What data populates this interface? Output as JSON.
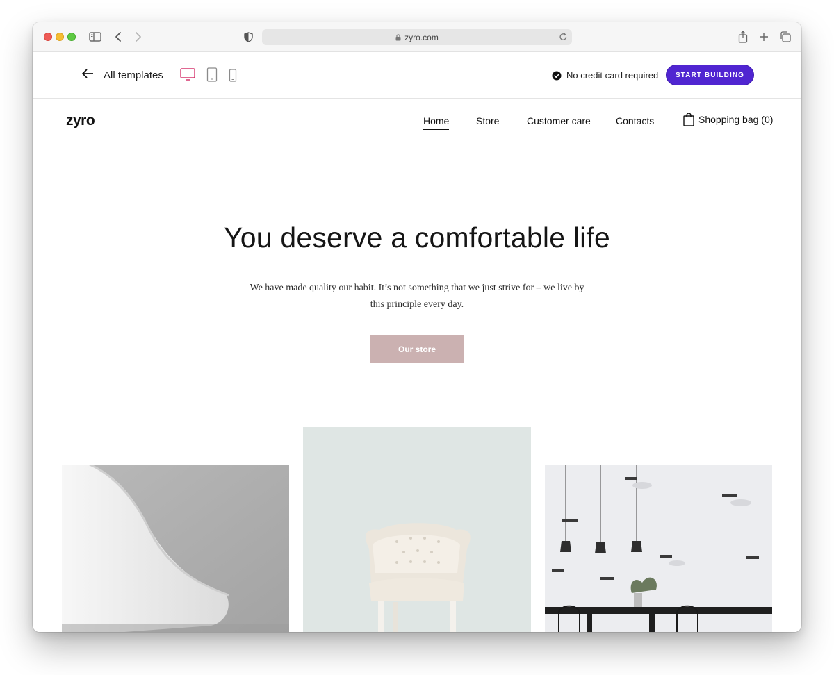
{
  "browser": {
    "url": "zyro.com"
  },
  "toolbar": {
    "back_label": "All templates",
    "no_credit_label": "No credit card required",
    "start_label": "START BUILDING",
    "accent_color": "#5025d1",
    "active_device": "desktop"
  },
  "site": {
    "logo": "zyro",
    "nav": [
      "Home",
      "Store",
      "Customer care",
      "Contacts"
    ],
    "active_nav": "Home",
    "cart_label": "Shopping bag (0)"
  },
  "hero": {
    "headline": "You deserve a comfortable life",
    "subtext": "We have made quality our habit. It’s not something that we just strive for – we live by this principle every day.",
    "cta_label": "Our store",
    "cta_color": "#cbb1b1"
  },
  "gallery": {
    "items": [
      "white-chair-closeup-image",
      "tufted-armchair-image",
      "dining-room-pendant-lamps-image"
    ]
  }
}
